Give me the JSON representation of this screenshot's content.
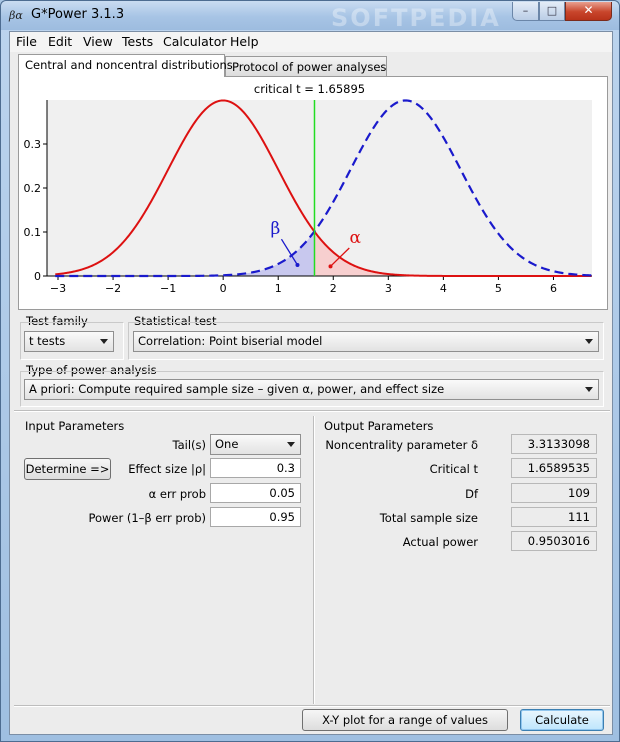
{
  "window": {
    "title": "G*Power 3.1.3",
    "app_icon_text": "βα",
    "watermark": "SOFTPEDIA"
  },
  "menu": [
    "File",
    "Edit",
    "View",
    "Tests",
    "Calculator",
    "Help"
  ],
  "tabs": [
    {
      "label": "Central and noncentral distributions",
      "active": true
    },
    {
      "label": "Protocol of power analyses",
      "active": false
    }
  ],
  "chart_data": {
    "type": "line",
    "title": "critical t = 1.65895",
    "critical_t": 1.65895,
    "xlim": [
      -3.2,
      6.7
    ],
    "ylim": [
      0,
      0.4
    ],
    "x_ticks": [
      -3,
      -2,
      -1,
      0,
      1,
      2,
      3,
      4,
      5,
      6
    ],
    "y_ticks": [
      0,
      0.1,
      0.2,
      0.3
    ],
    "y_tick_labels": [
      "0",
      "0.1",
      "0.2",
      "0.3"
    ],
    "series": [
      {
        "type": "central",
        "mean": 0,
        "color": "#dd1111",
        "style": "solid"
      },
      {
        "type": "noncentral",
        "mean": 3.3133098,
        "color": "#1a1acc",
        "style": "dashed"
      }
    ],
    "annotations": [
      {
        "text": "β",
        "x": 0.95,
        "y": 0.095,
        "color": "#1a1acc",
        "arrow_to": [
          1.35,
          0.025
        ]
      },
      {
        "text": "α",
        "x": 2.4,
        "y": 0.075,
        "color": "#dd1111",
        "arrow_to": [
          1.95,
          0.022
        ]
      }
    ],
    "critical_line_color": "#22dd22",
    "beta_fill": "#c8c8ee",
    "alpha_fill": "#f7cfcf"
  },
  "test_family": {
    "label": "Test family",
    "value": "t tests"
  },
  "statistical_test": {
    "label": "Statistical test",
    "value": "Correlation: Point biserial model"
  },
  "power_analysis": {
    "label": "Type of power analysis",
    "value": "A priori: Compute required sample size – given α, power, and effect size"
  },
  "input": {
    "title": "Input Parameters",
    "determine_label": "Determine =>",
    "tails_label": "Tail(s)",
    "tails_value": "One",
    "effect_label": "Effect size |ρ|",
    "effect_value": "0.3",
    "alpha_label": "α err prob",
    "alpha_value": "0.05",
    "power_label": "Power (1–β err prob)",
    "power_value": "0.95"
  },
  "output": {
    "title": "Output Parameters",
    "rows": [
      {
        "label": "Noncentrality parameter δ",
        "value": "3.3133098"
      },
      {
        "label": "Critical t",
        "value": "1.6589535"
      },
      {
        "label": "Df",
        "value": "109"
      },
      {
        "label": "Total sample size",
        "value": "111"
      },
      {
        "label": "Actual power",
        "value": "0.9503016"
      }
    ]
  },
  "buttons": {
    "xy_plot": "X-Y plot for a range of values",
    "calculate": "Calculate"
  }
}
